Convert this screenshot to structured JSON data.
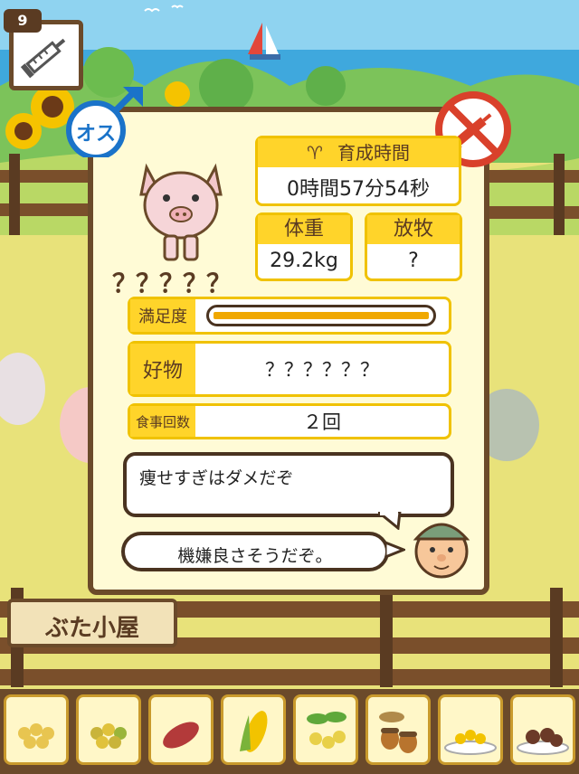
{
  "hud": {
    "syringe_count": "9"
  },
  "pig": {
    "name": "？？？？？",
    "gender_label": "オス",
    "growth_time_label": "育成時間",
    "growth_time_value": "0時間57分54秒",
    "weight_label": "体重",
    "weight_value": "29.2kg",
    "release_label": "放牧",
    "release_value": "?",
    "satisfaction_label": "満足度",
    "satisfaction_level": 1.0,
    "favorite_label": "好物",
    "favorite_value": "？？？？？？",
    "meals_label": "食事回数",
    "meals_value": "２回"
  },
  "dialogue": {
    "bubble1": "痩せすぎはダメだぞ",
    "bubble2": "機嫌良さそうだぞ。"
  },
  "sign": {
    "text": "ぶた小屋"
  },
  "food_bar": {
    "items": [
      "grain-icon",
      "corn-kernels-icon",
      "sweet-potato-icon",
      "corn-cob-icon",
      "soybean-icon",
      "acorn-icon",
      "corn-plate-icon",
      "meatball-plate-icon"
    ]
  },
  "colors": {
    "accent": "#ffd42a",
    "frame": "#6b4a2a",
    "panel_bg": "#fffbd6",
    "male_blue": "#1a73c9",
    "no_syringe_red": "#d9412b"
  }
}
